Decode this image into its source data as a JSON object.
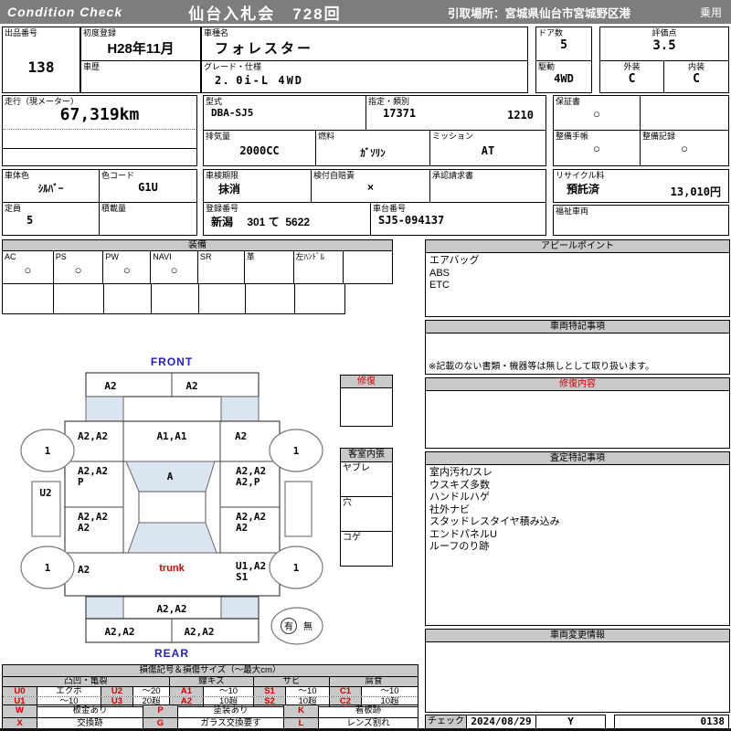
{
  "header": {
    "brand": "Condition  Check",
    "auction_title": "仙台入札会　728回",
    "pickup_location": "引取場所：宮城県仙台市宮城野区港",
    "vehicle_class": "乗用"
  },
  "info": {
    "lot": {
      "label": "出品番号",
      "value": "138"
    },
    "first_reg": {
      "label": "初度登録",
      "value": "H28年11月"
    },
    "history": {
      "label": "車歴",
      "value": ""
    },
    "model": {
      "label": "車種名",
      "value": "フォレスター"
    },
    "grade": {
      "label": "グレード・仕様",
      "value": "2．0i-L  4WD"
    },
    "doors": {
      "label": "ドア数",
      "value": "5"
    },
    "drive": {
      "label": "駆動",
      "value": "4WD"
    },
    "score": {
      "label": "評価点",
      "value": "3.5"
    },
    "exterior": {
      "label": "外装",
      "value": "C"
    },
    "interior": {
      "label": "内装",
      "value": "C"
    },
    "mileage": {
      "label": "走行（現メーター）",
      "value": "67,319km"
    },
    "model_code": {
      "label": "型式",
      "value": "DBA-SJ5"
    },
    "designation": {
      "label": "指定・類別",
      "value1": "17371",
      "value2": "1210"
    },
    "warranty": {
      "label": "保証書",
      "value": "○"
    },
    "displacement": {
      "label": "排気量",
      "value": "2000CC"
    },
    "fuel": {
      "label": "燃料",
      "value": "ｶﾞｿﾘﾝ"
    },
    "transmission": {
      "label": "ミッション",
      "value": "AT"
    },
    "maintenance_book": {
      "label": "整備手帳",
      "value": "○"
    },
    "maintenance_record": {
      "label": "整備記録",
      "value": "○"
    },
    "body_color": {
      "label": "車体色",
      "value": "ｼﾙﾊﾞｰ"
    },
    "color_code": {
      "label": "色コード",
      "value": "G1U"
    },
    "inspection": {
      "label": "車検期限",
      "value": "抹消"
    },
    "insured": {
      "label": "検付自賠責",
      "value": "×"
    },
    "approval": {
      "label": "承認請求書",
      "value": ""
    },
    "recycle": {
      "label": "リサイクル料",
      "status": "預託済",
      "fee": "13,010円"
    },
    "capacity": {
      "label": "定員",
      "value": "5"
    },
    "load": {
      "label": "積載量",
      "value": ""
    },
    "plate": {
      "label": "登録番号",
      "value": "新潟　 301 て  5622"
    },
    "chassis": {
      "label": "車台番号",
      "value": "SJ5-094137"
    },
    "welfare": {
      "label": "福祉車両",
      "value": ""
    }
  },
  "equipment": {
    "title": "装備",
    "items": [
      {
        "label": "AC",
        "value": "○"
      },
      {
        "label": "PS",
        "value": "○"
      },
      {
        "label": "PW",
        "value": "○"
      },
      {
        "label": "NAVI",
        "value": "○"
      },
      {
        "label": "SR",
        "value": ""
      },
      {
        "label": "革",
        "value": ""
      },
      {
        "label": "左ﾊﾝﾄﾞﾙ",
        "value": ""
      },
      {
        "label": "",
        "value": ""
      }
    ]
  },
  "panels": {
    "appeal": {
      "title": "アピールポイント",
      "lines": [
        "エアバッグ",
        "ABS",
        "ETC"
      ]
    },
    "notes": {
      "title": "車両特記事項",
      "disclaimer": "※記載のない書類・機器等は無しとして取り扱います。"
    },
    "repair": {
      "title": "修復内容"
    },
    "assessment": {
      "title": "査定特記事項",
      "lines": [
        "室内汚れ/スレ",
        "ウスキズ多数",
        "ハンドルハゲ",
        "社外ナビ",
        "スタッドレスタイヤ積み込み",
        "エンドパネルU",
        "ルーフのり跡"
      ]
    },
    "change": {
      "title": "車両変更情報"
    }
  },
  "middle": {
    "repair_title": "修復",
    "interior_title": "客室内張",
    "interior_items": [
      "ヤブレ",
      "穴",
      "コゲ"
    ]
  },
  "diagram": {
    "front_label": "FRONT",
    "rear_label": "REAR",
    "front_bumper_left": "A2",
    "front_bumper_right": "A2",
    "fender_front_left": "A2,A2",
    "hood": "A1,A1",
    "fender_front_right": "A2",
    "door_front_left_1": "A2,A2",
    "door_front_left_2": "P",
    "windshield": "A",
    "door_front_right_1": "A2,A2",
    "door_front_right_2": "A2,P",
    "door_rear_left_1": "A2,A2",
    "door_rear_left_2": "A2",
    "door_rear_right_1": "A2,A2",
    "door_rear_right_2": "A2",
    "quarter_left": "A2",
    "trunk": "trunk",
    "quarter_right_1": "U1,A2",
    "quarter_right_2": "S1",
    "rear_bumper_top": "A2,A2",
    "rear_bumper_left": "A2,A2",
    "rear_bumper_right": "A2,A2",
    "sill_left": "U2",
    "tire_front_left": "1",
    "tire_front_right": "1",
    "tire_rear_left": "1",
    "tire_rear_right": "1",
    "spare_yes": "有",
    "spare_no": "無"
  },
  "legend": {
    "title": "損傷記号＆損傷サイズ（〜最大cm）",
    "groups": [
      "凸凹・亀裂",
      "線キズ",
      "サビ",
      "腐食"
    ],
    "rows": [
      [
        "U0",
        "エクボ",
        "U2",
        "〜20",
        "A1",
        "〜10",
        "S1",
        "〜10",
        "C1",
        "〜10"
      ],
      [
        "U1",
        "〜10",
        "U3",
        "20超",
        "A2",
        "10超",
        "S2",
        "10超",
        "C2",
        "10超"
      ]
    ],
    "rows2": [
      [
        "W",
        "板金あり",
        "P",
        "塗装あり",
        "K",
        "看板跡"
      ],
      [
        "X",
        "交換跡",
        "G",
        "ガラス交換要す",
        "L",
        "レンズ割れ"
      ]
    ]
  },
  "footer": {
    "check_label": "チェック",
    "date": "2024/08/29",
    "sign": "Y",
    "number": "0138"
  },
  "colors": {
    "accent_blue": "#2222bb",
    "accent_red": "#cc0000",
    "glass_blue": "#dbe5f1",
    "header_gray": "#7d7d7d",
    "panel_gray": "#c9c9c9"
  }
}
